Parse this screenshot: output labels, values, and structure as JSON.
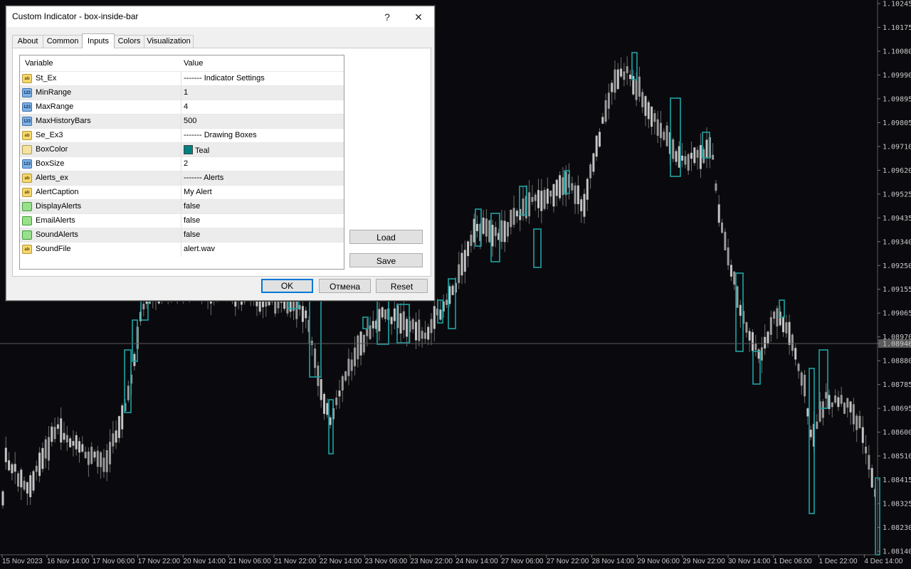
{
  "chart": {
    "price_labels": [
      "1.10245",
      "1.10175",
      "1.10080",
      "1.09990",
      "1.09895",
      "1.09805",
      "1.09710",
      "1.09620",
      "1.09525",
      "1.09435",
      "1.09340",
      "1.09250",
      "1.09155",
      "1.09065",
      "1.08970",
      "1.08946",
      "1.08880",
      "1.08785",
      "1.08695",
      "1.08600",
      "1.08510",
      "1.08415",
      "1.08325",
      "1.08230",
      "1.08140"
    ],
    "time_labels": [
      "15 Nov 2023",
      "16 Nov 14:00",
      "17 Nov 06:00",
      "17 Nov 22:00",
      "20 Nov 14:00",
      "21 Nov 06:00",
      "21 Nov 22:00",
      "22 Nov 14:00",
      "23 Nov 06:00",
      "23 Nov 22:00",
      "24 Nov 14:00",
      "27 Nov 06:00",
      "27 Nov 22:00",
      "28 Nov 14:00",
      "29 Nov 06:00",
      "29 Nov 22:00",
      "30 Nov 14:00",
      "1 Dec 06:00",
      "1 Dec 22:00",
      "4 Dec 14:00"
    ],
    "current_price": "1.08946",
    "candle_color": "#9a9a9a",
    "box_color": "#1fa3a3",
    "background": "#0a0a0e"
  },
  "dialog": {
    "title": "Custom Indicator - box-inside-bar",
    "help_symbol": "?",
    "close_symbol": "✕",
    "tabs": [
      {
        "label": "About"
      },
      {
        "label": "Common"
      },
      {
        "label": "Inputs"
      },
      {
        "label": "Colors"
      },
      {
        "label": "Visualization"
      }
    ],
    "active_tab": "Inputs",
    "grid": {
      "col_variable": "Variable",
      "col_value": "Value",
      "rows": [
        {
          "type": "ab",
          "icon_text": "ab",
          "variable": "St_Ex",
          "value": "------- Indicator Settings"
        },
        {
          "type": "num",
          "icon_text": "123",
          "variable": "MinRange",
          "value": "1"
        },
        {
          "type": "num",
          "icon_text": "123",
          "variable": "MaxRange",
          "value": "4"
        },
        {
          "type": "num",
          "icon_text": "123",
          "variable": "MaxHistoryBars",
          "value": "500"
        },
        {
          "type": "ab",
          "icon_text": "ab",
          "variable": "Se_Ex3",
          "value": "------- Drawing Boxes"
        },
        {
          "type": "color",
          "icon_text": "",
          "variable": "BoxColor",
          "value": "Teal",
          "swatch": "#008080"
        },
        {
          "type": "num",
          "icon_text": "123",
          "variable": "BoxSize",
          "value": "2"
        },
        {
          "type": "ab",
          "icon_text": "ab",
          "variable": "Alerts_ex",
          "value": "------- Alerts"
        },
        {
          "type": "ab",
          "icon_text": "ab",
          "variable": "AlertCaption",
          "value": "My Alert"
        },
        {
          "type": "bool",
          "icon_text": "",
          "variable": "DisplayAlerts",
          "value": "false"
        },
        {
          "type": "bool",
          "icon_text": "",
          "variable": "EmailAlerts",
          "value": "false"
        },
        {
          "type": "bool",
          "icon_text": "",
          "variable": "SoundAlerts",
          "value": "false"
        },
        {
          "type": "ab",
          "icon_text": "ab",
          "variable": "SoundFile",
          "value": "alert.wav"
        }
      ]
    },
    "buttons": {
      "load": "Load",
      "save": "Save",
      "ok": "OK",
      "cancel": "Отмена",
      "reset": "Reset"
    }
  }
}
